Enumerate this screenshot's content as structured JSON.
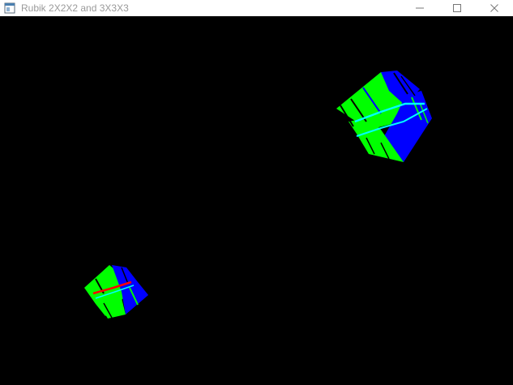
{
  "window": {
    "title": "Rubik 2X2X2 and 3X3X3",
    "icons": {
      "app": "app-window-icon",
      "minimize": "minimize-icon",
      "maximize": "maximize-icon",
      "close": "close-icon"
    }
  },
  "scene": {
    "background": "#000000",
    "colors": {
      "green": "#00ff00",
      "blue": "#0000ff",
      "cyan": "#00ffff",
      "red": "#ff0000"
    },
    "objects": [
      "cube-3x3x3",
      "cube-2x2x2"
    ]
  }
}
